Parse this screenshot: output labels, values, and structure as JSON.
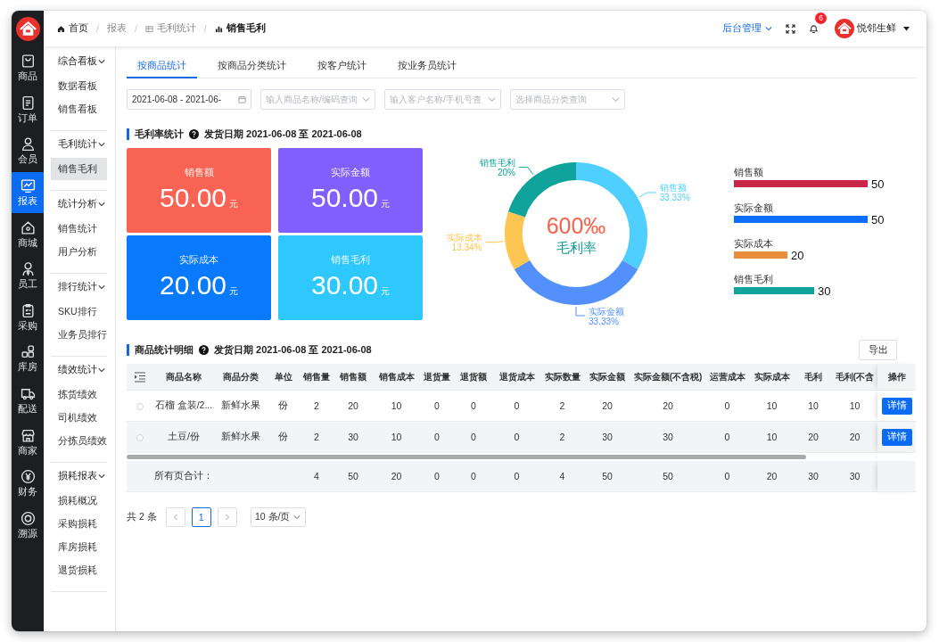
{
  "nav_rail": {
    "items": [
      {
        "label": "商品",
        "selected": false
      },
      {
        "label": "订单",
        "selected": false
      },
      {
        "label": "会员",
        "selected": false
      },
      {
        "label": "报表",
        "selected": true
      },
      {
        "label": "商城",
        "selected": false
      },
      {
        "label": "员工",
        "selected": false
      },
      {
        "label": "采购",
        "selected": false
      },
      {
        "label": "库房",
        "selected": false
      },
      {
        "label": "配送",
        "selected": false
      },
      {
        "label": "商家",
        "selected": false
      },
      {
        "label": "财务",
        "selected": false
      },
      {
        "label": "溯源",
        "selected": false
      }
    ]
  },
  "submenu": {
    "groups": [
      {
        "title": "综合看板",
        "expanded": true,
        "items": [
          {
            "label": "数据看板",
            "selected": false
          },
          {
            "label": "销售看板",
            "selected": false
          }
        ]
      },
      {
        "title": "毛利统计",
        "expanded": true,
        "items": [
          {
            "label": "销售毛利",
            "selected": true
          }
        ]
      },
      {
        "title": "统计分析",
        "expanded": true,
        "items": [
          {
            "label": "销售统计",
            "selected": false
          },
          {
            "label": "用户分析",
            "selected": false
          }
        ]
      },
      {
        "title": "排行统计",
        "expanded": true,
        "items": [
          {
            "label": "SKU排行",
            "selected": false
          },
          {
            "label": "业务员排行",
            "selected": false
          }
        ]
      },
      {
        "title": "绩效统计",
        "expanded": true,
        "items": [
          {
            "label": "拣货绩效",
            "selected": false
          },
          {
            "label": "司机绩效",
            "selected": false
          },
          {
            "label": "分拣员绩效",
            "selected": false
          }
        ]
      },
      {
        "title": "损耗报表",
        "expanded": true,
        "items": [
          {
            "label": "损耗概况",
            "selected": false
          },
          {
            "label": "采购损耗",
            "selected": false
          },
          {
            "label": "库房损耗",
            "selected": false
          },
          {
            "label": "退货损耗",
            "selected": false
          }
        ]
      }
    ]
  },
  "breadcrumb": {
    "separator": "/",
    "items": [
      {
        "label": "首页",
        "current": false
      },
      {
        "label": "报表",
        "current": false
      },
      {
        "label": "毛利统计",
        "current": false
      },
      {
        "label": "销售毛利",
        "current": true
      }
    ]
  },
  "header_actions": {
    "admin_menu": "后台管理",
    "notification_count": "6",
    "user_name": "悦邻生鲜"
  },
  "tabs": [
    {
      "label": "按商品统计",
      "selected": true
    },
    {
      "label": "按商品分类统计",
      "selected": false
    },
    {
      "label": "按客户统计",
      "selected": false
    },
    {
      "label": "按业务员统计",
      "selected": false
    }
  ],
  "filters": [
    {
      "kind": "date_range",
      "value": "2021-06-08 - 2021-06-"
    },
    {
      "kind": "select",
      "placeholder": "输入商品名称/编码查询"
    },
    {
      "kind": "select",
      "placeholder": "输入客户名称/手机号查"
    },
    {
      "kind": "select",
      "placeholder": "选择商品分类查询"
    }
  ],
  "summary_section": {
    "title": "毛利率统计",
    "subtitle": "发货日期 2021-06-08 至 2021-06-08",
    "cards": [
      {
        "label": "销售额",
        "value": "50.00",
        "unit": "元",
        "color": "#f96353"
      },
      {
        "label": "实际金额",
        "value": "50.00",
        "unit": "元",
        "color": "#805ffc"
      },
      {
        "label": "实际成本",
        "value": "20.00",
        "unit": "元",
        "color": "#0a7afc"
      },
      {
        "label": "销售毛利",
        "value": "30.00",
        "unit": "元",
        "color": "#2ec8fd"
      }
    ],
    "ratio_chart": {
      "center_value": "600‰",
      "center_label": "毛利率",
      "chart_data": {
        "type": "donut",
        "categories": [
          "销售额",
          "实际金额",
          "实际成本",
          "销售毛利"
        ],
        "values": [
          33.33,
          33.33,
          13.34,
          20
        ],
        "colors": [
          "#4fcffd",
          "#5490fc",
          "#fdc551",
          "#0fa39b"
        ],
        "data_labels": true,
        "value_labels": [
          "33.33%",
          "33.33%",
          "13.34%",
          "20%"
        ]
      }
    },
    "amount_chart": {
      "chart_data": {
        "type": "bar",
        "orientation": "horizontal",
        "categories": [
          "销售额",
          "实际金额",
          "实际成本",
          "销售毛利"
        ],
        "values": [
          50,
          50,
          20,
          30
        ],
        "colors": [
          "#c9264a",
          "#0b6ffc",
          "#e88d3a",
          "#0fa39b"
        ],
        "data_labels": true
      }
    }
  },
  "detail_section": {
    "title": "商品统计明细",
    "subtitle": "发货日期 2021-06-08 至 2021-06-08",
    "export_button": "导出",
    "table": {
      "columns": [
        "商品名称",
        "商品分类",
        "单位",
        "销售量",
        "销售额",
        "销售成本",
        "退货量",
        "退货额",
        "退货成本",
        "实际数量",
        "实际金额",
        "实际金额(不含税)",
        "运营成本",
        "实际成本",
        "毛利",
        "毛利(不含"
      ],
      "action_column": "操作",
      "rows": [
        {
          "selected": false,
          "cells": [
            "石榴 盒装/2...",
            "新鲜水果",
            "份",
            "2",
            "20",
            "10",
            "0",
            "0",
            "0",
            "2",
            "20",
            "20",
            "0",
            "10",
            "10",
            "10"
          ],
          "action": "详情"
        },
        {
          "selected": false,
          "cells": [
            "土豆/份",
            "新鲜水果",
            "份",
            "2",
            "30",
            "10",
            "0",
            "0",
            "0",
            "2",
            "30",
            "30",
            "0",
            "10",
            "20",
            "20"
          ],
          "action": "详情"
        }
      ],
      "summary": {
        "label": "所有页合计：",
        "cells": [
          "4",
          "50",
          "20",
          "0",
          "0",
          "0",
          "4",
          "50",
          "50",
          "0",
          "20",
          "30",
          "30"
        ]
      }
    }
  },
  "pagination": {
    "total": "共 2 条",
    "pages": [
      {
        "label": "1",
        "selected": true
      }
    ],
    "page_size": "10 条/页"
  }
}
